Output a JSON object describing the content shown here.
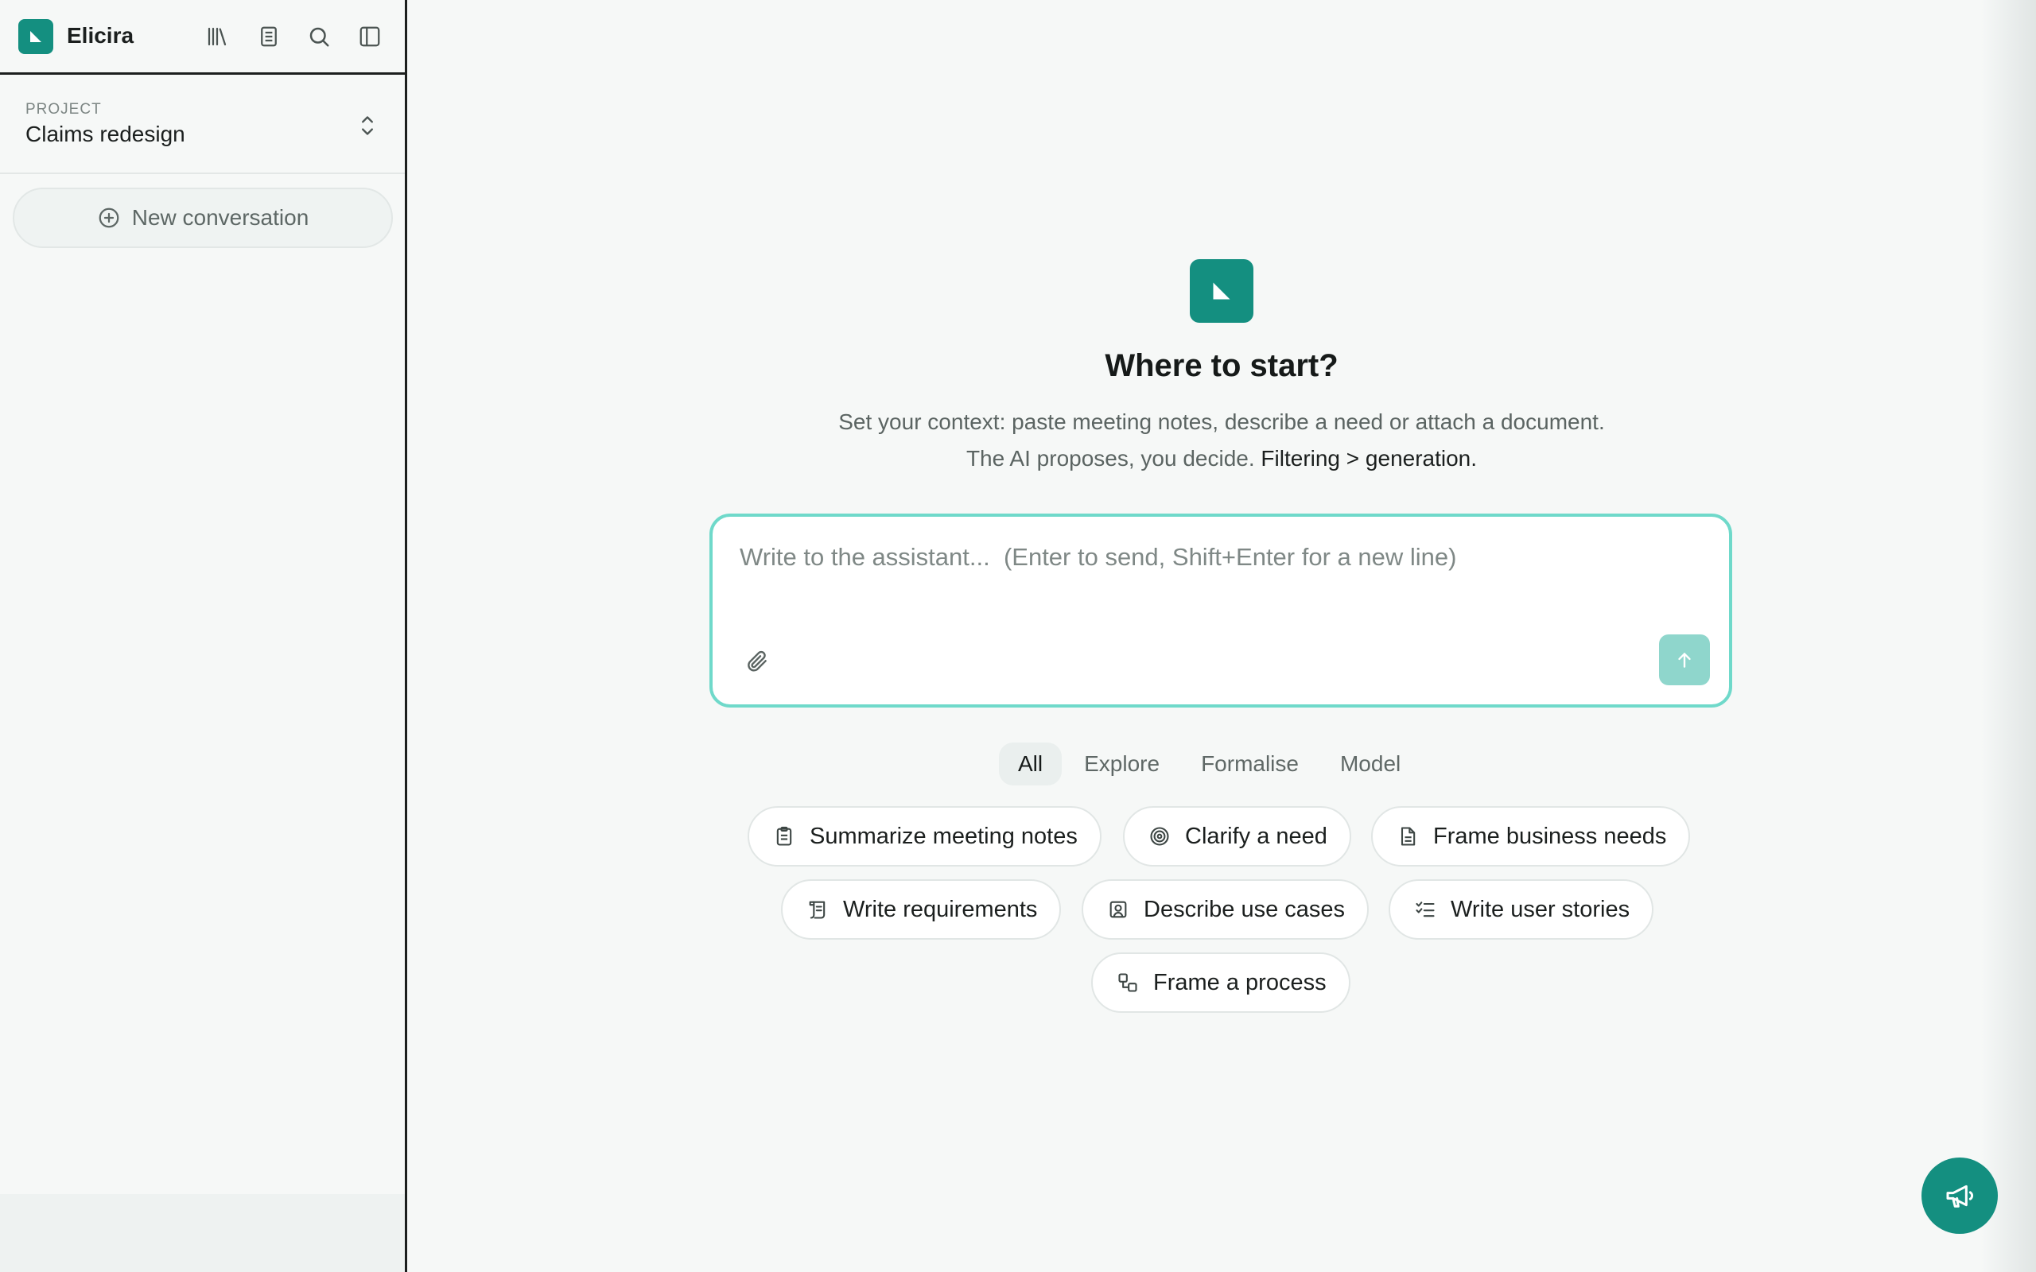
{
  "app": {
    "name": "Elicira"
  },
  "header_icons": [
    "library-icon",
    "notebook-icon",
    "search-icon",
    "sidebar-toggle-icon"
  ],
  "project": {
    "label": "PROJECT",
    "name": "Claims redesign"
  },
  "sidebar": {
    "new_conversation_label": "New conversation"
  },
  "hero": {
    "title": "Where to start?",
    "subtitle_main": "Set your context: paste meeting notes, describe a need or attach a document. The AI proposes, you decide.",
    "subtitle_emphasis": "Filtering > generation."
  },
  "composer": {
    "value": "",
    "placeholder": "Write to the assistant...  (Enter to send, Shift+Enter for a new line)"
  },
  "filters": [
    {
      "label": "All",
      "active": true
    },
    {
      "label": "Explore",
      "active": false
    },
    {
      "label": "Formalise",
      "active": false
    },
    {
      "label": "Model",
      "active": false
    }
  ],
  "suggestions": [
    {
      "label": "Summarize meeting notes",
      "icon": "clipboard-icon"
    },
    {
      "label": "Clarify a need",
      "icon": "target-icon"
    },
    {
      "label": "Frame business needs",
      "icon": "document-icon"
    },
    {
      "label": "Write requirements",
      "icon": "scroll-icon"
    },
    {
      "label": "Describe use cases",
      "icon": "user-square-icon"
    },
    {
      "label": "Write user stories",
      "icon": "list-checks-icon"
    },
    {
      "label": "Frame a process",
      "icon": "workflow-icon"
    }
  ],
  "colors": {
    "brand": "#148f80",
    "composer_border": "#6fd9ca",
    "send_button": "#8fd6cc",
    "background": "#f6f8f7"
  }
}
